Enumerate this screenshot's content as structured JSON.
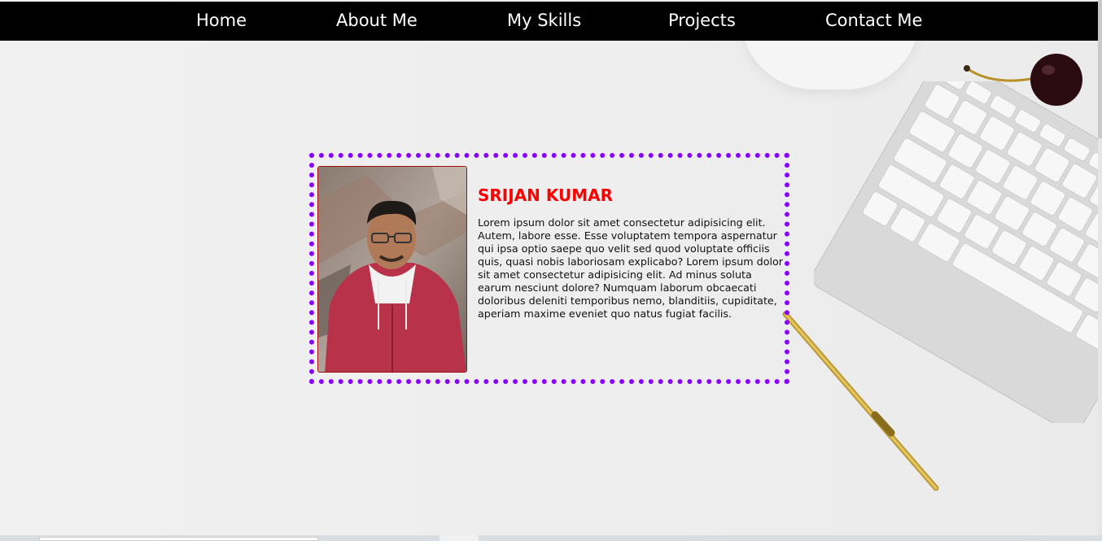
{
  "nav": {
    "items": [
      {
        "label": "Home"
      },
      {
        "label": "About Me"
      },
      {
        "label": "My Skills"
      },
      {
        "label": "Projects"
      },
      {
        "label": "Contact Me"
      }
    ]
  },
  "profile": {
    "name": "SRIJAN KUMAR",
    "bio": "Lorem ipsum dolor sit amet consectetur adipisicing elit. Autem, labore esse. Esse voluptatem tempora aspernatur qui ipsa optio saepe quo velit sed quod voluptate officiis quis, quasi nobis laboriosam explicabo? Lorem ipsum dolor sit amet consectetur adipisicing elit. Ad minus soluta earum nesciunt dolore? Numquam laborum obcaecati doloribus deleniti temporibus nemo, blanditiis, cupiditate, aperiam maxime eveniet quo natus fugiat facilis."
  },
  "colors": {
    "nav_bg": "#000000",
    "nav_text": "#ffffff",
    "card_border": "#8a00ff",
    "name": "#ff0000"
  },
  "icons": {
    "profile_photo": "profile-photo",
    "background": "keyboard-pen-cherry-desk"
  }
}
